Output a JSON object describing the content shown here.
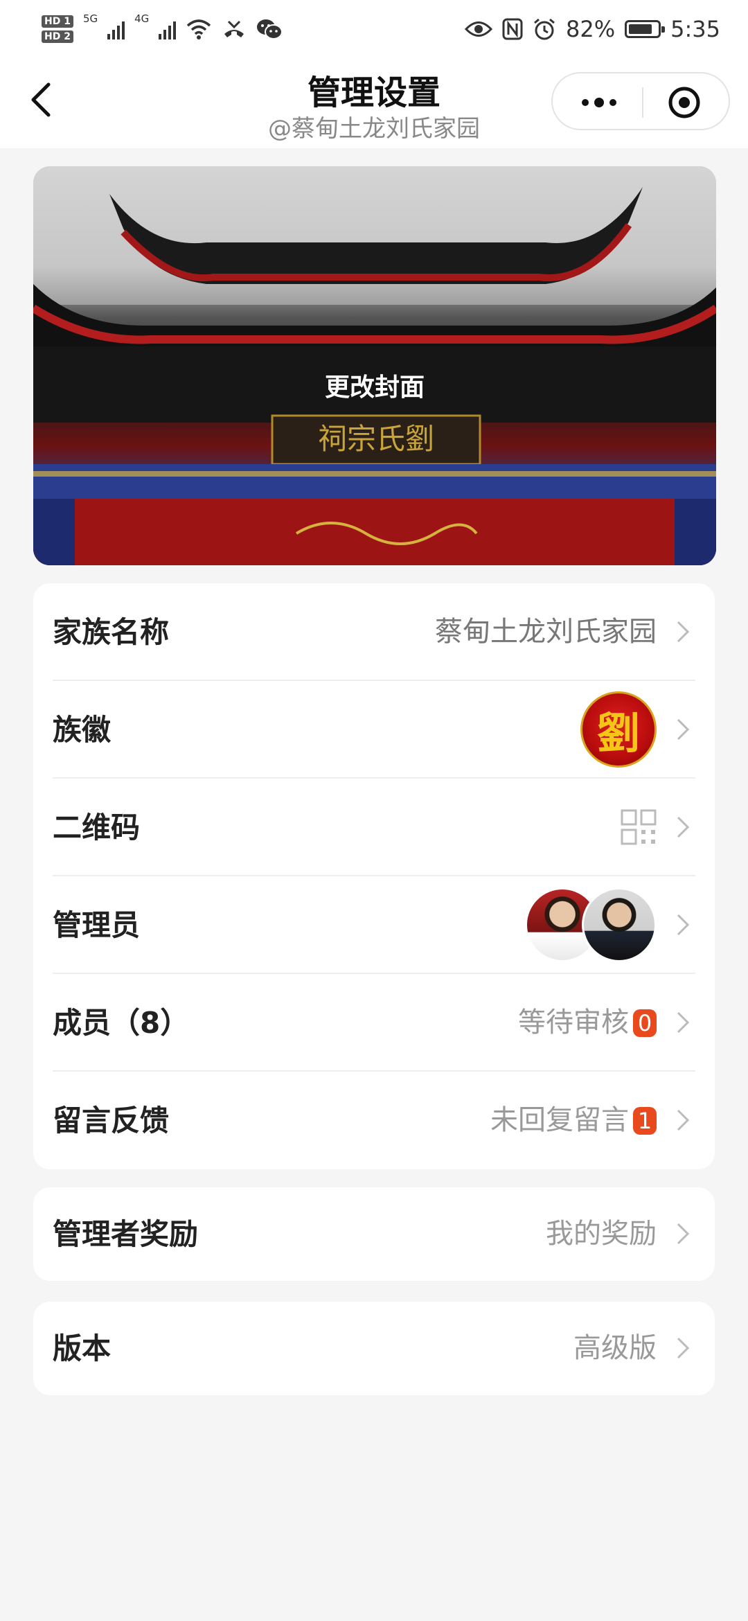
{
  "status_bar": {
    "hd1": "HD 1",
    "hd2": "HD 2",
    "net1": "5G",
    "net2": "4G",
    "battery_percent": "82%",
    "battery_level": 0.82,
    "time": "5:35",
    "icons": [
      "signal-icon",
      "wifi-icon",
      "missed-call-icon",
      "wechat-icon",
      "eye-icon",
      "nfc-icon",
      "alarm-icon",
      "battery-icon"
    ]
  },
  "header": {
    "title": "管理设置",
    "subtitle": "@蔡甸土龙刘氏家园"
  },
  "cover": {
    "change_label": "更改封面",
    "sign_text": "祠宗氏劉"
  },
  "settings": {
    "rows": [
      {
        "label": "家族名称",
        "value": "蔡甸土龙刘氏家园"
      },
      {
        "label": "族徽",
        "emblem_char": "劉"
      },
      {
        "label": "二维码",
        "icon": "qrcode-icon"
      },
      {
        "label": "管理员",
        "avatars": 2
      },
      {
        "label": "成员（8）",
        "value": "等待审核",
        "badge": "0"
      },
      {
        "label": "留言反馈",
        "value": "未回复留言",
        "badge": "1"
      }
    ]
  },
  "rewards": {
    "label": "管理者奖励",
    "value": "我的奖励"
  },
  "version": {
    "label": "版本",
    "value": "高级版"
  },
  "colors": {
    "badge": "#e8491d",
    "background": "#f5f5f5",
    "emblem_red": "#c0111a",
    "emblem_gold": "#f5c518"
  }
}
